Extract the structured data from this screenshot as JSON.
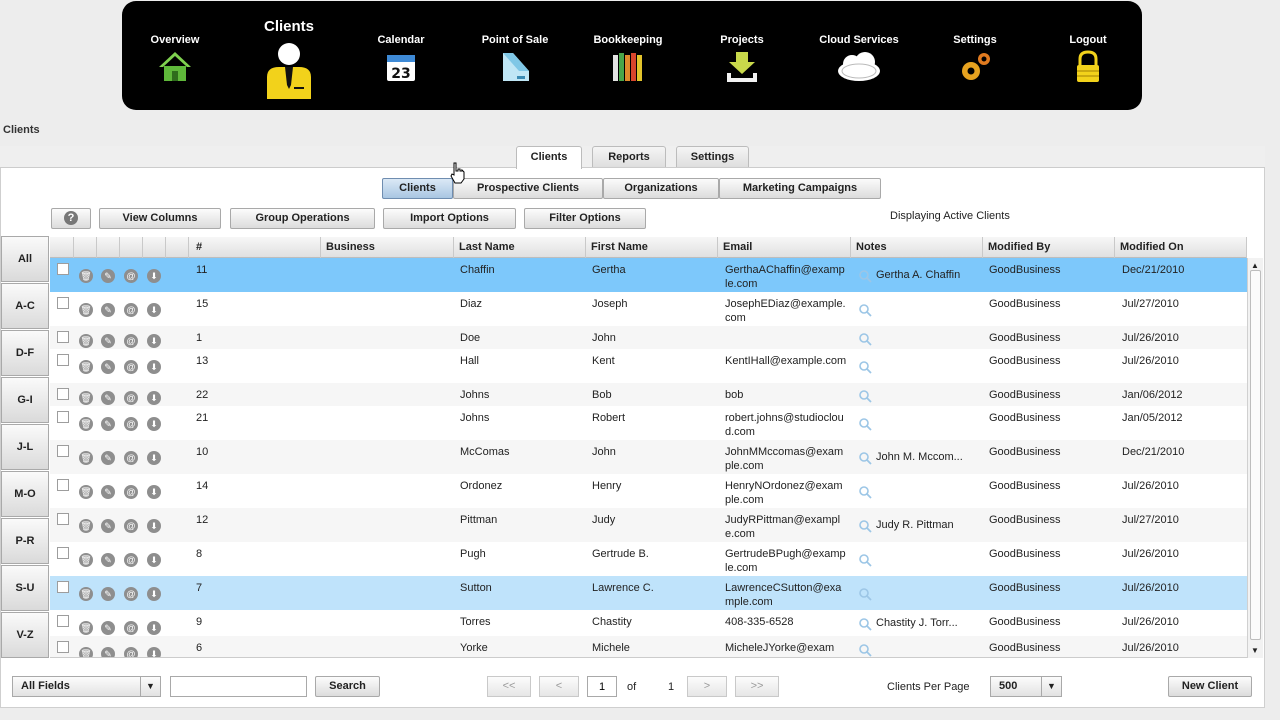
{
  "nav": [
    {
      "label": "Overview",
      "icon": "house-icon",
      "active": false
    },
    {
      "label": "Clients",
      "icon": "person-icon",
      "active": true
    },
    {
      "label": "Calendar",
      "icon": "calendar-icon",
      "active": false,
      "icon_text": "23"
    },
    {
      "label": "Point of Sale",
      "icon": "register-icon",
      "active": false
    },
    {
      "label": "Bookkeeping",
      "icon": "books-icon",
      "active": false
    },
    {
      "label": "Projects",
      "icon": "download-tray-icon",
      "active": false
    },
    {
      "label": "Cloud Services",
      "icon": "cloud-icon",
      "active": false
    },
    {
      "label": "Settings",
      "icon": "gears-icon",
      "active": false
    },
    {
      "label": "Logout",
      "icon": "lock-icon",
      "active": false
    }
  ],
  "breadcrumb": "Clients",
  "tabs": [
    "Clients",
    "Reports",
    "Settings"
  ],
  "subtabs": [
    "Clients",
    "Prospective Clients",
    "Organizations",
    "Marketing Campaigns"
  ],
  "toolbar": {
    "help": "?",
    "view_columns": "View Columns",
    "group_operations": "Group Operations",
    "import_options": "Import Options",
    "filter_options": "Filter Options"
  },
  "status": "Displaying Active Clients",
  "alpha": [
    "All",
    "A-C",
    "D-F",
    "G-I",
    "J-L",
    "M-O",
    "P-R",
    "S-U",
    "V-Z"
  ],
  "columns": [
    "#",
    "Business",
    "Last Name",
    "First Name",
    "Email",
    "Notes",
    "Modified By",
    "Modified On"
  ],
  "rows": [
    {
      "num": "11",
      "business": "",
      "last": "Chaffin",
      "first": "Gertha",
      "email": "GerthaAChaffin@example.com",
      "notes": "Gertha A. Chaffin",
      "modified_by": "GoodBusiness",
      "modified_on": "Dec/21/2010",
      "state": "selected"
    },
    {
      "num": "15",
      "business": "",
      "last": "Diaz",
      "first": "Joseph",
      "email": "JosephEDiaz@example.com",
      "notes": "",
      "modified_by": "GoodBusiness",
      "modified_on": "Jul/27/2010",
      "state": ""
    },
    {
      "num": "1",
      "business": "",
      "last": "Doe",
      "first": "John",
      "email": "",
      "notes": "",
      "modified_by": "GoodBusiness",
      "modified_on": "Jul/26/2010",
      "state": "alt"
    },
    {
      "num": "13",
      "business": "",
      "last": "Hall",
      "first": "Kent",
      "email": "KentIHall@example.com",
      "notes": "",
      "modified_by": "GoodBusiness",
      "modified_on": "Jul/26/2010",
      "state": ""
    },
    {
      "num": "22",
      "business": "",
      "last": "Johns",
      "first": "Bob",
      "email": "bob",
      "notes": "",
      "modified_by": "GoodBusiness",
      "modified_on": "Jan/06/2012",
      "state": "alt"
    },
    {
      "num": "21",
      "business": "",
      "last": "Johns",
      "first": "Robert",
      "email": "robert.johns@studiocloud.com",
      "notes": "",
      "modified_by": "GoodBusiness",
      "modified_on": "Jan/05/2012",
      "state": ""
    },
    {
      "num": "10",
      "business": "",
      "last": "McComas",
      "first": "John",
      "email": "JohnMMccomas@example.com",
      "notes": "John M. Mccom...",
      "modified_by": "GoodBusiness",
      "modified_on": "Dec/21/2010",
      "state": "alt"
    },
    {
      "num": "14",
      "business": "",
      "last": "Ordonez",
      "first": "Henry",
      "email": "HenryNOrdonez@example.com",
      "notes": "",
      "modified_by": "GoodBusiness",
      "modified_on": "Jul/26/2010",
      "state": ""
    },
    {
      "num": "12",
      "business": "",
      "last": "Pittman",
      "first": "Judy",
      "email": "JudyRPittman@example.com",
      "notes": "Judy R. Pittman",
      "modified_by": "GoodBusiness",
      "modified_on": "Jul/27/2010",
      "state": "alt"
    },
    {
      "num": "8",
      "business": "",
      "last": "Pugh",
      "first": "Gertrude B.",
      "email": "GertrudeBPugh@example.com",
      "notes": "",
      "modified_by": "GoodBusiness",
      "modified_on": "Jul/26/2010",
      "state": ""
    },
    {
      "num": "7",
      "business": "",
      "last": "Sutton",
      "first": "Lawrence C.",
      "email": "LawrenceCSutton@example.com",
      "notes": "",
      "modified_by": "GoodBusiness",
      "modified_on": "Jul/26/2010",
      "state": "highlight"
    },
    {
      "num": "9",
      "business": "",
      "last": "Torres",
      "first": "Chastity",
      "email": "408-335-6528",
      "notes": "Chastity J. Torr...",
      "modified_by": "GoodBusiness",
      "modified_on": "Jul/26/2010",
      "state": ""
    },
    {
      "num": "6",
      "business": "",
      "last": "Yorke",
      "first": "Michele",
      "email": "MicheleJYorke@exam",
      "notes": "",
      "modified_by": "GoodBusiness",
      "modified_on": "Jul/26/2010",
      "state": "alt"
    }
  ],
  "footer": {
    "field_select": "All Fields",
    "search_value": "",
    "search_button": "Search",
    "first": "<<",
    "prev": "<",
    "page": "1",
    "of": "of",
    "total_pages": "1",
    "next": ">",
    "last": ">>",
    "per_page_label": "Clients Per Page",
    "per_page_value": "500",
    "new_client": "New Client"
  },
  "colors": {
    "selected_row": "#7dc8fb",
    "highlight_row": "#bfe3fb",
    "nav_bg": "#000000"
  }
}
